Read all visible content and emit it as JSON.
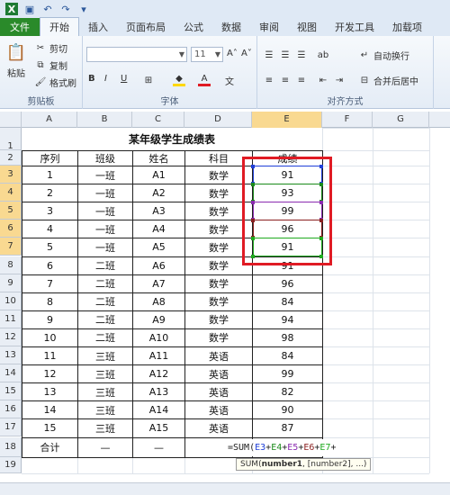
{
  "qat": {
    "icons": [
      "save-icon",
      "undo-icon",
      "redo-icon",
      "customize-icon"
    ]
  },
  "tabs": [
    "文件",
    "开始",
    "插入",
    "页面布局",
    "公式",
    "数据",
    "审阅",
    "视图",
    "开发工具",
    "加载项"
  ],
  "ribbon": {
    "clipboard": {
      "paste": "粘贴",
      "cut": "剪切",
      "copy": "复制",
      "format_painter": "格式刷",
      "label": "剪贴板"
    },
    "font": {
      "size": "11",
      "grow": "A˄",
      "shrink": "A˅",
      "bold": "B",
      "italic": "I",
      "underline": "U",
      "label": "字体"
    },
    "alignment": {
      "wrap": "自动换行",
      "merge": "合并后居中",
      "label": "对齐方式"
    }
  },
  "columns": [
    "A",
    "B",
    "C",
    "D",
    "E",
    "F",
    "G"
  ],
  "rows": [
    "1",
    "2",
    "3",
    "4",
    "5",
    "6",
    "7",
    "8",
    "9",
    "10",
    "11",
    "12",
    "13",
    "14",
    "15",
    "16",
    "17",
    "18",
    "19"
  ],
  "sheet": {
    "title": "某年级学生成绩表",
    "headers": [
      "序列",
      "班级",
      "姓名",
      "科目",
      "成绩"
    ],
    "data": [
      [
        "1",
        "一班",
        "A1",
        "数学",
        "91"
      ],
      [
        "2",
        "一班",
        "A2",
        "数学",
        "93"
      ],
      [
        "3",
        "一班",
        "A3",
        "数学",
        "99"
      ],
      [
        "4",
        "一班",
        "A4",
        "数学",
        "96"
      ],
      [
        "5",
        "一班",
        "A5",
        "数学",
        "91"
      ],
      [
        "6",
        "二班",
        "A6",
        "数学",
        "91"
      ],
      [
        "7",
        "二班",
        "A7",
        "数学",
        "96"
      ],
      [
        "8",
        "二班",
        "A8",
        "数学",
        "84"
      ],
      [
        "9",
        "二班",
        "A9",
        "数学",
        "94"
      ],
      [
        "10",
        "二班",
        "A10",
        "数学",
        "98"
      ],
      [
        "11",
        "三班",
        "A11",
        "英语",
        "84"
      ],
      [
        "12",
        "三班",
        "A12",
        "英语",
        "99"
      ],
      [
        "13",
        "三班",
        "A13",
        "英语",
        "82"
      ],
      [
        "14",
        "三班",
        "A14",
        "英语",
        "90"
      ],
      [
        "15",
        "三班",
        "A15",
        "英语",
        "87"
      ]
    ],
    "total_row": [
      "合计",
      "—",
      "—"
    ]
  },
  "formula": {
    "prefix": "=SUM(",
    "refs": [
      {
        "text": "E3",
        "color": "#1f3fd8"
      },
      {
        "text": "E4",
        "color": "#1a8a1a"
      },
      {
        "text": "E5",
        "color": "#8a2bb0"
      },
      {
        "text": "E6",
        "color": "#8a1f1f"
      },
      {
        "text": "E7",
        "color": "#1faa1f"
      }
    ],
    "plus": "+",
    "tooltip_fn": "SUM(",
    "tooltip_bold": "number1",
    "tooltip_rest": ", [number2], ...)"
  },
  "accent": {
    "selection": "#f9d991",
    "highlight_box": "#e01b24",
    "file_tab": "#2a8a2a"
  }
}
